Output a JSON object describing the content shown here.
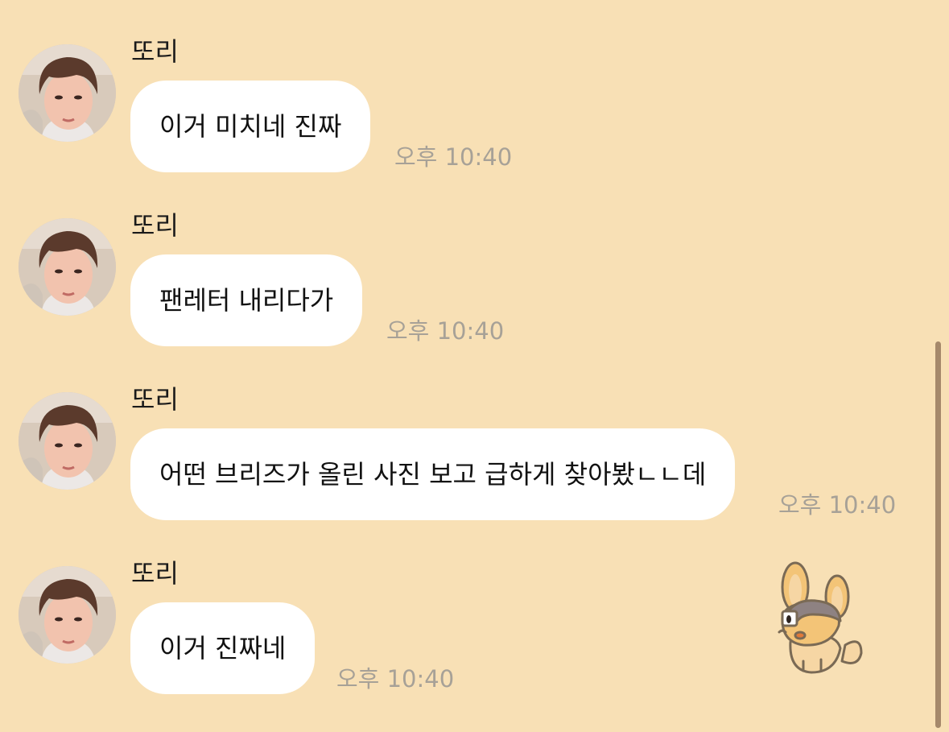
{
  "theme": {
    "background": "#f8e0b5",
    "bubble": "#ffffff",
    "timestamp": "#a7a197",
    "scrollbar": "#a5896b"
  },
  "messages": [
    {
      "sender": "또리",
      "text": "이거 미치네 진짜",
      "time": "오후 10:40"
    },
    {
      "sender": "또리",
      "text": "팬레터 내리다가",
      "time": "오후 10:40"
    },
    {
      "sender": "또리",
      "text": "어떤 브리즈가 올린 사진 보고 급하게 찾아봤ㄴㄴ데",
      "time": "오후 10:40"
    },
    {
      "sender": "또리",
      "text": "이거 진짜네",
      "time": "오후 10:40"
    }
  ],
  "sticker": {
    "icon": "fox-sticker-icon"
  }
}
